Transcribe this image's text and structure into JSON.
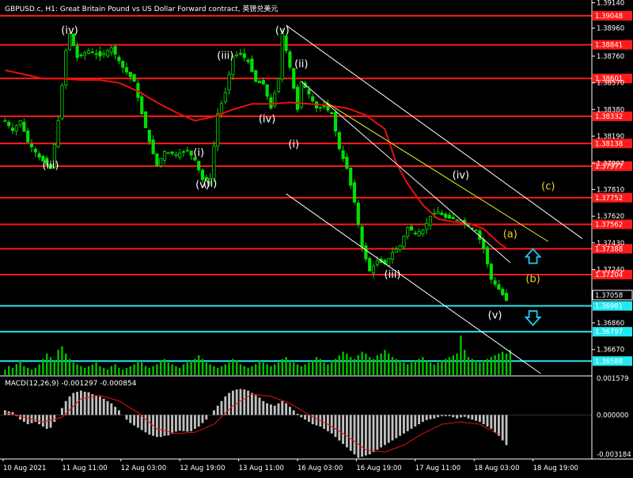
{
  "header": {
    "title": "GBPUSD.c, H1:  Great Britain Pound vs US Dollar Forward contract, 英镑兑美元"
  },
  "chart_data": {
    "type": "candlestick",
    "symbol": "GBPUSD.c",
    "timeframe": "H1",
    "grid": false,
    "price_axis": {
      "ylim": [
        1.36488,
        1.3916
      ],
      "ticks": [
        "1.39140",
        "1.38960",
        "1.38760",
        "1.38570",
        "1.38380",
        "1.38190",
        "1.37997",
        "1.37810",
        "1.37620",
        "1.37430",
        "1.37240",
        "1.37058",
        "1.36860",
        "1.36670"
      ]
    },
    "time_labels": [
      "10 Aug 2021",
      "11 Aug 11:00",
      "12 Aug 03:00",
      "12 Aug 19:00",
      "13 Aug 11:00",
      "16 Aug 03:00",
      "16 Aug 19:00",
      "17 Aug 11:00",
      "18 Aug 03:00",
      "18 Aug 19:00"
    ],
    "current_price": "1.37058",
    "horizontal_levels": [
      {
        "price": 1.39048,
        "label": "1.39048",
        "color": "#ff1a1a"
      },
      {
        "price": 1.38841,
        "label": "1.38841",
        "color": "#ff1a1a"
      },
      {
        "price": 1.38601,
        "label": "1.38601",
        "color": "#ff1a1a"
      },
      {
        "price": 1.38332,
        "label": "1.38332",
        "color": "#ff1a1a"
      },
      {
        "price": 1.38138,
        "label": "1.38138",
        "color": "#ff1a1a"
      },
      {
        "price": 1.37977,
        "label": "1.37977",
        "color": "#ff1a1a"
      },
      {
        "price": 1.37752,
        "label": "1.37752",
        "color": "#ff1a1a"
      },
      {
        "price": 1.37562,
        "label": "1.37562",
        "color": "#ff1a1a"
      },
      {
        "price": 1.37388,
        "label": "1.37388",
        "color": "#ff1a1a"
      },
      {
        "price": 1.37204,
        "label": "1.37204",
        "color": "#ff1a1a"
      },
      {
        "price": 1.36981,
        "label": "1.36981",
        "color": "#22e8f0"
      },
      {
        "price": 1.36797,
        "label": "1.36797",
        "color": "#22e8f0"
      },
      {
        "price": 1.36588,
        "label": "1.36588",
        "color": "#22e8f0"
      }
    ],
    "wave_labels": [
      {
        "text": "(iv)",
        "color": "#ffffff",
        "price": 1.3892,
        "bar": 17
      },
      {
        "text": "(iii)",
        "color": "#ffffff",
        "price": 1.3796,
        "bar": 12
      },
      {
        "text": "(iii)",
        "color": "#ffffff",
        "price": 1.3874,
        "bar": 58
      },
      {
        "text": "(v)",
        "color": "#ffffff",
        "price": 1.3892,
        "bar": 73
      },
      {
        "text": "(ii)",
        "color": "#ffffff",
        "price": 1.3868,
        "bar": 78
      },
      {
        "text": "(iv)",
        "color": "#ffffff",
        "price": 1.3829,
        "bar": 69
      },
      {
        "text": "(i)",
        "color": "#ffffff",
        "price": 1.3811,
        "bar": 76
      },
      {
        "text": "(i)",
        "color": "#ffffff",
        "price": 1.3805,
        "bar": 51
      },
      {
        "text": "(ii)",
        "color": "#ffffff",
        "price": 1.3783,
        "bar": 54
      },
      {
        "text": "(v)",
        "color": "#ffffff",
        "price": 1.3782,
        "bar": 52
      },
      {
        "text": "(iii)",
        "color": "#ffffff",
        "price": 1.3718,
        "bar": 102
      },
      {
        "text": "(iv)",
        "color": "#ffffff",
        "price": 1.3789,
        "bar": 120
      },
      {
        "text": "(v)",
        "color": "#ffffff",
        "price": 1.3689,
        "bar": 129
      },
      {
        "text": "(c)",
        "color": "#f0d020",
        "price": 1.3781,
        "bar": 143
      },
      {
        "text": "(a)",
        "color": "#f0d020",
        "price": 1.3747,
        "bar": 133
      },
      {
        "text": "(b)",
        "color": "#f0d020",
        "price": 1.3715,
        "bar": 139
      }
    ],
    "arrows": [
      {
        "direction": "up",
        "color": "#22c8f0",
        "price": 1.3733,
        "bar": 139
      },
      {
        "direction": "down",
        "color": "#22c8f0",
        "price": 1.369,
        "bar": 139
      }
    ],
    "channels": [
      {
        "color": "#ffffff",
        "from": {
          "bar": 74,
          "price": 1.3898
        },
        "to": {
          "bar": 152,
          "price": 1.3746
        }
      },
      {
        "color": "#ffffff",
        "from": {
          "bar": 78,
          "price": 1.3858
        },
        "to": {
          "bar": 133,
          "price": 1.3729
        }
      },
      {
        "color": "#ffffff",
        "from": {
          "bar": 74,
          "price": 1.3778
        },
        "to": {
          "bar": 141,
          "price": 1.365
        }
      },
      {
        "color": "#f0f020",
        "from": {
          "bar": 84,
          "price": 1.3844
        },
        "to": {
          "bar": 143,
          "price": 1.3744
        }
      }
    ],
    "ma_series": {
      "name": "",
      "color": "#e81010",
      "values": [
        [
          0,
          1.3866
        ],
        [
          5,
          1.3863
        ],
        [
          10,
          1.386
        ],
        [
          15,
          1.386
        ],
        [
          20,
          1.3859
        ],
        [
          25,
          1.3859
        ],
        [
          30,
          1.3857
        ],
        [
          35,
          1.3851
        ],
        [
          40,
          1.3843
        ],
        [
          45,
          1.3836
        ],
        [
          50,
          1.383
        ],
        [
          55,
          1.3833
        ],
        [
          60,
          1.3838
        ],
        [
          65,
          1.3842
        ],
        [
          70,
          1.3842
        ],
        [
          75,
          1.3843
        ],
        [
          80,
          1.3842
        ],
        [
          85,
          1.3841
        ],
        [
          90,
          1.3839
        ],
        [
          95,
          1.3834
        ],
        [
          100,
          1.3824
        ],
        [
          103,
          1.38
        ],
        [
          106,
          1.3785
        ],
        [
          110,
          1.377
        ],
        [
          114,
          1.376
        ],
        [
          118,
          1.3758
        ],
        [
          122,
          1.3757
        ],
        [
          126,
          1.3753
        ],
        [
          130,
          1.3743
        ],
        [
          132,
          1.3739
        ]
      ]
    },
    "price_path": [
      [
        0,
        1.383
      ],
      [
        2,
        1.3823
      ],
      [
        4,
        1.383
      ],
      [
        6,
        1.3815
      ],
      [
        9,
        1.3804
      ],
      [
        12,
        1.3796
      ],
      [
        14,
        1.383
      ],
      [
        16,
        1.388
      ],
      [
        17,
        1.3892
      ],
      [
        19,
        1.3875
      ],
      [
        22,
        1.388
      ],
      [
        25,
        1.3876
      ],
      [
        28,
        1.3882
      ],
      [
        31,
        1.3868
      ],
      [
        34,
        1.3858
      ],
      [
        36,
        1.3835
      ],
      [
        38,
        1.3815
      ],
      [
        40,
        1.3798
      ],
      [
        42,
        1.3808
      ],
      [
        45,
        1.3806
      ],
      [
        48,
        1.3809
      ],
      [
        50,
        1.3802
      ],
      [
        52,
        1.3788
      ],
      [
        54,
        1.3789
      ],
      [
        56,
        1.3835
      ],
      [
        58,
        1.385
      ],
      [
        60,
        1.3876
      ],
      [
        62,
        1.3878
      ],
      [
        64,
        1.3872
      ],
      [
        66,
        1.3858
      ],
      [
        68,
        1.3856
      ],
      [
        70,
        1.3839
      ],
      [
        72,
        1.386
      ],
      [
        73,
        1.3892
      ],
      [
        75,
        1.3868
      ],
      [
        77,
        1.3838
      ],
      [
        78,
        1.3858
      ],
      [
        80,
        1.3849
      ],
      [
        82,
        1.3839
      ],
      [
        84,
        1.384
      ],
      [
        86,
        1.3835
      ],
      [
        88,
        1.381
      ],
      [
        90,
        1.3796
      ],
      [
        92,
        1.3772
      ],
      [
        94,
        1.374
      ],
      [
        96,
        1.3723
      ],
      [
        98,
        1.373
      ],
      [
        100,
        1.3728
      ],
      [
        102,
        1.3736
      ],
      [
        104,
        1.3741
      ],
      [
        106,
        1.3754
      ],
      [
        108,
        1.375
      ],
      [
        110,
        1.3752
      ],
      [
        112,
        1.3762
      ],
      [
        114,
        1.3765
      ],
      [
        116,
        1.3761
      ],
      [
        118,
        1.376
      ],
      [
        120,
        1.3759
      ],
      [
        122,
        1.3755
      ],
      [
        124,
        1.3752
      ],
      [
        126,
        1.3739
      ],
      [
        128,
        1.3717
      ],
      [
        130,
        1.371
      ],
      [
        132,
        1.3702
      ]
    ],
    "bars_total": 155,
    "volume_panel": {
      "volumes": [
        3,
        5,
        4,
        6,
        8,
        5,
        4,
        3,
        4,
        6,
        9,
        12,
        10,
        8,
        14,
        16,
        12,
        9,
        7,
        6,
        5,
        4,
        5,
        6,
        7,
        5,
        4,
        3,
        5,
        6,
        4,
        3,
        4,
        5,
        6,
        8,
        7,
        5,
        4,
        5,
        6,
        8,
        9,
        7,
        6,
        5,
        4,
        6,
        7,
        8,
        9,
        11,
        9,
        7,
        6,
        5,
        4,
        5,
        6,
        7,
        9,
        8,
        6,
        5,
        4,
        5,
        6,
        8,
        7,
        6,
        5,
        6,
        7,
        9,
        10,
        8,
        7,
        6,
        5,
        6,
        7,
        8,
        10,
        9,
        7,
        6,
        8,
        9,
        11,
        13,
        12,
        10,
        9,
        11,
        13,
        12,
        10,
        9,
        11,
        12,
        14,
        12,
        10,
        9,
        8,
        7,
        6,
        7,
        8,
        9,
        10,
        8,
        7,
        6,
        7,
        8,
        9,
        10,
        11,
        12,
        22,
        14,
        10,
        9,
        8,
        7,
        8,
        9,
        10,
        11,
        12,
        13,
        12,
        14
      ]
    },
    "macd": {
      "label": "MACD(12,26,9) -0.001297 -0.000854",
      "ylim": [
        -0.0019,
        0.00165
      ],
      "ticks": [
        "0.001579",
        "0.000000",
        "-0.003184"
      ],
      "histogram": [
        0.0002,
        0.00015,
        0.00012,
        -5e-05,
        -0.0002,
        -0.0003,
        -0.0004,
        -0.00035,
        -0.0003,
        -0.0004,
        -0.0005,
        -0.0006,
        -0.00055,
        -0.0003,
        0.0,
        0.0003,
        0.0006,
        0.0008,
        0.00095,
        0.001,
        0.00105,
        0.001,
        0.00098,
        0.0009,
        0.00085,
        0.0008,
        0.0007,
        0.0006,
        0.0005,
        0.00035,
        0.0002,
        0.0,
        -0.0002,
        -0.00035,
        -0.00045,
        -0.00055,
        -0.00065,
        -0.00075,
        -0.00085,
        -0.0009,
        -0.00095,
        -0.00095,
        -0.0009,
        -0.00088,
        -0.0008,
        -0.00072,
        -0.00068,
        -0.0007,
        -0.00072,
        -0.0007,
        -0.0006,
        -0.0005,
        -0.00035,
        -0.0002,
        0.0,
        0.0002,
        0.0004,
        0.0006,
        0.0008,
        0.00095,
        0.00105,
        0.0011,
        0.00112,
        0.0011,
        0.00105,
        0.00095,
        0.00085,
        0.00075,
        0.0006,
        0.0005,
        0.00045,
        0.0004,
        0.0005,
        0.0006,
        0.0005,
        0.00035,
        0.0002,
        5e-05,
        -0.0001,
        -0.0002,
        -0.0003,
        -0.0004,
        -0.00045,
        -0.0005,
        -0.0006,
        -0.0007,
        -0.0008,
        -0.00095,
        -0.0011,
        -0.00125,
        -0.0014,
        -0.00155,
        -0.0017,
        -0.00185,
        -0.0018,
        -0.00175,
        -0.0017,
        -0.0016,
        -0.0015,
        -0.0014,
        -0.0013,
        -0.0012,
        -0.0011,
        -0.001,
        -0.0009,
        -0.0008,
        -0.0007,
        -0.0006,
        -0.0005,
        -0.0004,
        -0.0003,
        -0.00022,
        -0.00018,
        -0.00015,
        -0.0001,
        -5e-05,
        -5e-05,
        -5e-05,
        -0.0001,
        -0.00015,
        -0.0001,
        -8e-05,
        -0.00015,
        -0.0002,
        -0.00025,
        -0.0003,
        -0.0004,
        -0.0005,
        -0.0006,
        -0.00075,
        -0.0009,
        -0.0011,
        -0.0013
      ],
      "signal_color": "#e81010",
      "signal": [
        [
          0,
          0.0001
        ],
        [
          10,
          -0.0003
        ],
        [
          15,
          -0.0001
        ],
        [
          20,
          0.0007
        ],
        [
          25,
          0.00085
        ],
        [
          30,
          0.0006
        ],
        [
          35,
          0.0001
        ],
        [
          40,
          -0.0006
        ],
        [
          45,
          -0.0008
        ],
        [
          50,
          -0.00075
        ],
        [
          55,
          -0.0004
        ],
        [
          60,
          0.0004
        ],
        [
          65,
          0.0009
        ],
        [
          70,
          0.0008
        ],
        [
          75,
          0.0005
        ],
        [
          80,
          0.0
        ],
        [
          85,
          -0.0004
        ],
        [
          90,
          -0.0009
        ],
        [
          95,
          -0.0015
        ],
        [
          100,
          -0.0016
        ],
        [
          105,
          -0.0013
        ],
        [
          110,
          -0.0008
        ],
        [
          115,
          -0.0004
        ],
        [
          120,
          -0.0003
        ],
        [
          125,
          -0.0004
        ],
        [
          130,
          -0.00085
        ]
      ]
    }
  }
}
